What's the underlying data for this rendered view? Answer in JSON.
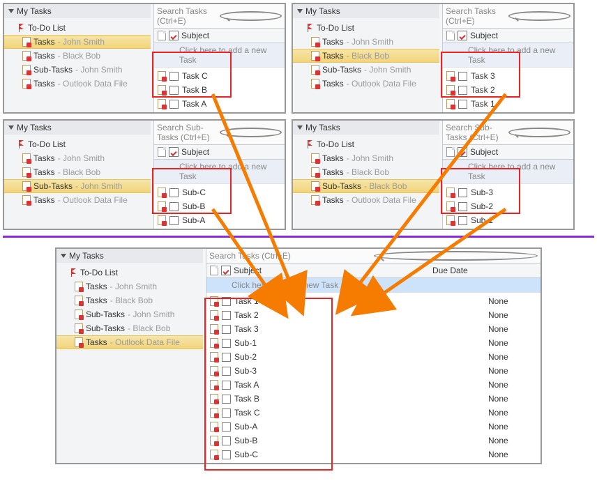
{
  "nav_header": "My Tasks",
  "todo_label": "To-Do List",
  "folders": {
    "tasks": "Tasks",
    "sub_tasks": "Sub-Tasks"
  },
  "sources": {
    "john": "John Smith",
    "bob": "Black Bob",
    "odf": "Outlook Data File"
  },
  "search": {
    "tasks": "Search Tasks (Ctrl+E)",
    "subtasks": "Search Sub-Tasks (Ctrl+E)"
  },
  "cols": {
    "subject": "Subject",
    "due": "Due Date"
  },
  "add_row": "Click here to add a new Task",
  "panels": {
    "p1": {
      "tasks": [
        "Task C",
        "Task B",
        "Task A"
      ]
    },
    "p2": {
      "tasks": [
        "Task 3",
        "Task 2",
        "Task 1"
      ]
    },
    "p3": {
      "tasks": [
        "Sub-C",
        "Sub-B",
        "Sub-A"
      ]
    },
    "p4": {
      "tasks": [
        "Sub-3",
        "Sub-2",
        "Sub-1"
      ]
    }
  },
  "merged": {
    "rows": [
      {
        "s": "Task 1",
        "d": "None"
      },
      {
        "s": "Task 2",
        "d": "None"
      },
      {
        "s": "Task 3",
        "d": "None"
      },
      {
        "s": "Sub-1",
        "d": "None"
      },
      {
        "s": "Sub-2",
        "d": "None"
      },
      {
        "s": "Sub-3",
        "d": "None"
      },
      {
        "s": "Task A",
        "d": "None"
      },
      {
        "s": "Task B",
        "d": "None"
      },
      {
        "s": "Task C",
        "d": "None"
      },
      {
        "s": "Sub-A",
        "d": "None"
      },
      {
        "s": "Sub-B",
        "d": "None"
      },
      {
        "s": "Sub-C",
        "d": "None"
      }
    ]
  }
}
